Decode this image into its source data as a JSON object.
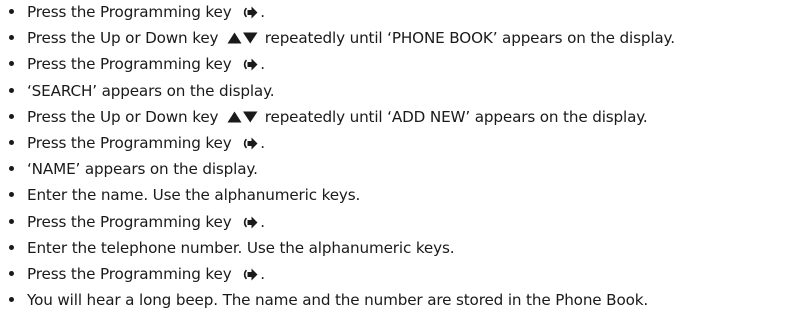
{
  "steps": [
    {
      "text_before": "Press the Programming key",
      "icon": "programming-key-icon",
      "text_after": "."
    },
    {
      "text_before": "Press the Up or Down key",
      "icon": "up-down-key-icon",
      "text_after": "repeatedly until ‘PHONE BOOK’ appears on the display."
    },
    {
      "text_before": "Press the Programming key",
      "icon": "programming-key-icon",
      "text_after": "."
    },
    {
      "text": "‘SEARCH’ appears on the display."
    },
    {
      "text_before": "Press the Up or Down key",
      "icon": "up-down-key-icon",
      "text_after": "repeatedly until ‘ADD NEW’ appears on the display."
    },
    {
      "text_before": "Press the Programming key",
      "icon": "programming-key-icon",
      "text_after": "."
    },
    {
      "text": "‘NAME’ appears on the display."
    },
    {
      "text": "Enter the name. Use the alphanumeric keys."
    },
    {
      "text_before": "Press the Programming key",
      "icon": "programming-key-icon",
      "text_after": "."
    },
    {
      "text": "Enter the telephone number. Use the alphanumeric keys."
    },
    {
      "text_before": "Press the Programming key",
      "icon": "programming-key-icon",
      "text_after": "."
    },
    {
      "text": "You will hear a long beep. The name and the number are stored in the Phone Book."
    }
  ],
  "colors": {
    "text": "#1a1a1a",
    "background": "#ffffff"
  }
}
